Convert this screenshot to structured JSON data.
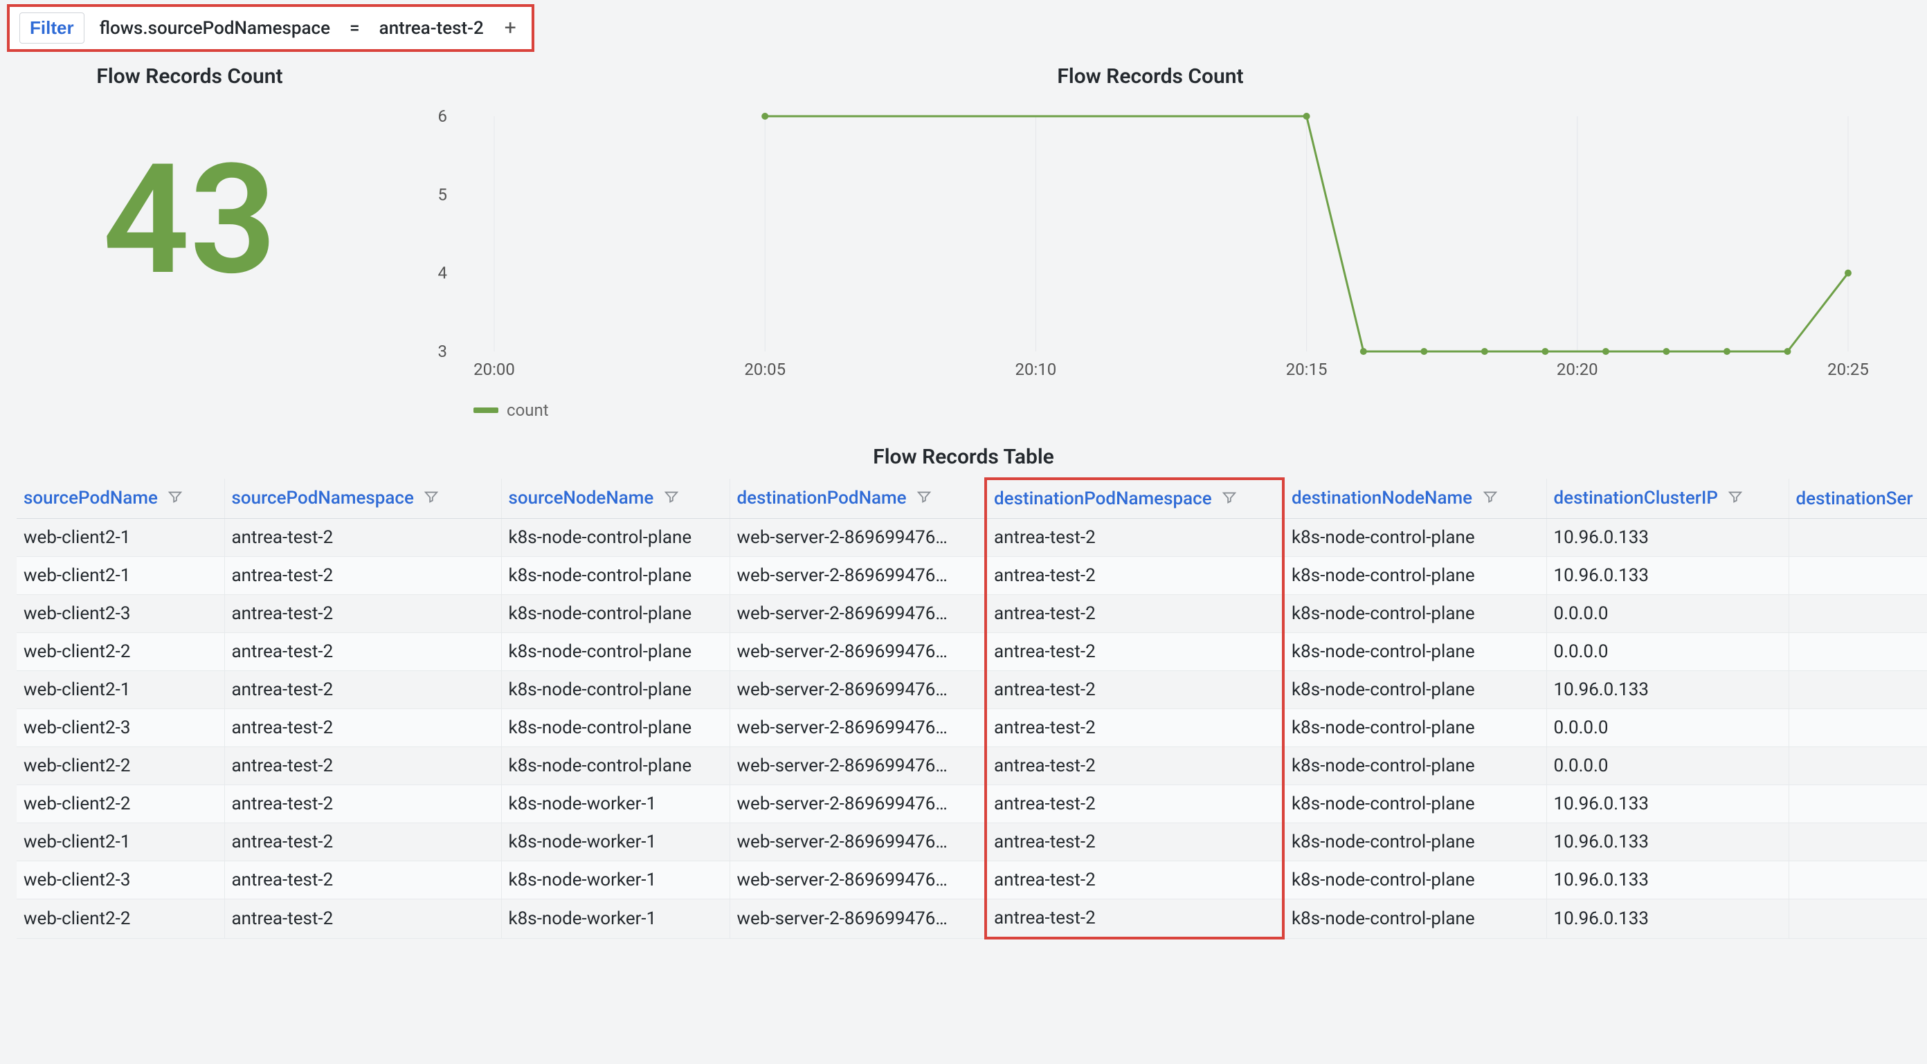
{
  "filter": {
    "button_label": "Filter",
    "field": "flows.sourcePodNamespace",
    "operator": "=",
    "value": "antrea-test-2",
    "add_label": "+"
  },
  "panels": {
    "count_title": "Flow Records Count",
    "big_number": "43",
    "chart_title": "Flow Records Count",
    "legend_label": "count"
  },
  "chart_data": {
    "type": "line",
    "series": [
      {
        "name": "count",
        "values": [
          6,
          6,
          3,
          3,
          3,
          3,
          3,
          3,
          3,
          3,
          4
        ]
      }
    ],
    "x_ticks": [
      "20:00",
      "20:05",
      "20:10",
      "20:15",
      "20:20",
      "20:25"
    ],
    "y_ticks": [
      3,
      4,
      5,
      6
    ],
    "ylim": [
      3,
      6
    ],
    "xlabel": "",
    "ylabel": ""
  },
  "table": {
    "title": "Flow Records Table",
    "highlight_col_index": 4,
    "columns": [
      "sourcePodName",
      "sourcePodNamespace",
      "sourceNodeName",
      "destinationPodName",
      "destinationPodNamespace",
      "destinationNodeName",
      "destinationClusterIP",
      "destinationSer"
    ],
    "rows": [
      [
        "web-client2-1",
        "antrea-test-2",
        "k8s-node-control-plane",
        "web-server-2-869699476…",
        "antrea-test-2",
        "k8s-node-control-plane",
        "10.96.0.133",
        ""
      ],
      [
        "web-client2-1",
        "antrea-test-2",
        "k8s-node-control-plane",
        "web-server-2-869699476…",
        "antrea-test-2",
        "k8s-node-control-plane",
        "10.96.0.133",
        ""
      ],
      [
        "web-client2-3",
        "antrea-test-2",
        "k8s-node-control-plane",
        "web-server-2-869699476…",
        "antrea-test-2",
        "k8s-node-control-plane",
        "0.0.0.0",
        ""
      ],
      [
        "web-client2-2",
        "antrea-test-2",
        "k8s-node-control-plane",
        "web-server-2-869699476…",
        "antrea-test-2",
        "k8s-node-control-plane",
        "0.0.0.0",
        ""
      ],
      [
        "web-client2-1",
        "antrea-test-2",
        "k8s-node-control-plane",
        "web-server-2-869699476…",
        "antrea-test-2",
        "k8s-node-control-plane",
        "10.96.0.133",
        ""
      ],
      [
        "web-client2-3",
        "antrea-test-2",
        "k8s-node-control-plane",
        "web-server-2-869699476…",
        "antrea-test-2",
        "k8s-node-control-plane",
        "0.0.0.0",
        ""
      ],
      [
        "web-client2-2",
        "antrea-test-2",
        "k8s-node-control-plane",
        "web-server-2-869699476…",
        "antrea-test-2",
        "k8s-node-control-plane",
        "0.0.0.0",
        ""
      ],
      [
        "web-client2-2",
        "antrea-test-2",
        "k8s-node-worker-1",
        "web-server-2-869699476…",
        "antrea-test-2",
        "k8s-node-control-plane",
        "10.96.0.133",
        ""
      ],
      [
        "web-client2-1",
        "antrea-test-2",
        "k8s-node-worker-1",
        "web-server-2-869699476…",
        "antrea-test-2",
        "k8s-node-control-plane",
        "10.96.0.133",
        ""
      ],
      [
        "web-client2-3",
        "antrea-test-2",
        "k8s-node-worker-1",
        "web-server-2-869699476…",
        "antrea-test-2",
        "k8s-node-control-plane",
        "10.96.0.133",
        ""
      ],
      [
        "web-client2-2",
        "antrea-test-2",
        "k8s-node-worker-1",
        "web-server-2-869699476…",
        "antrea-test-2",
        "k8s-node-control-plane",
        "10.96.0.133",
        ""
      ]
    ]
  }
}
